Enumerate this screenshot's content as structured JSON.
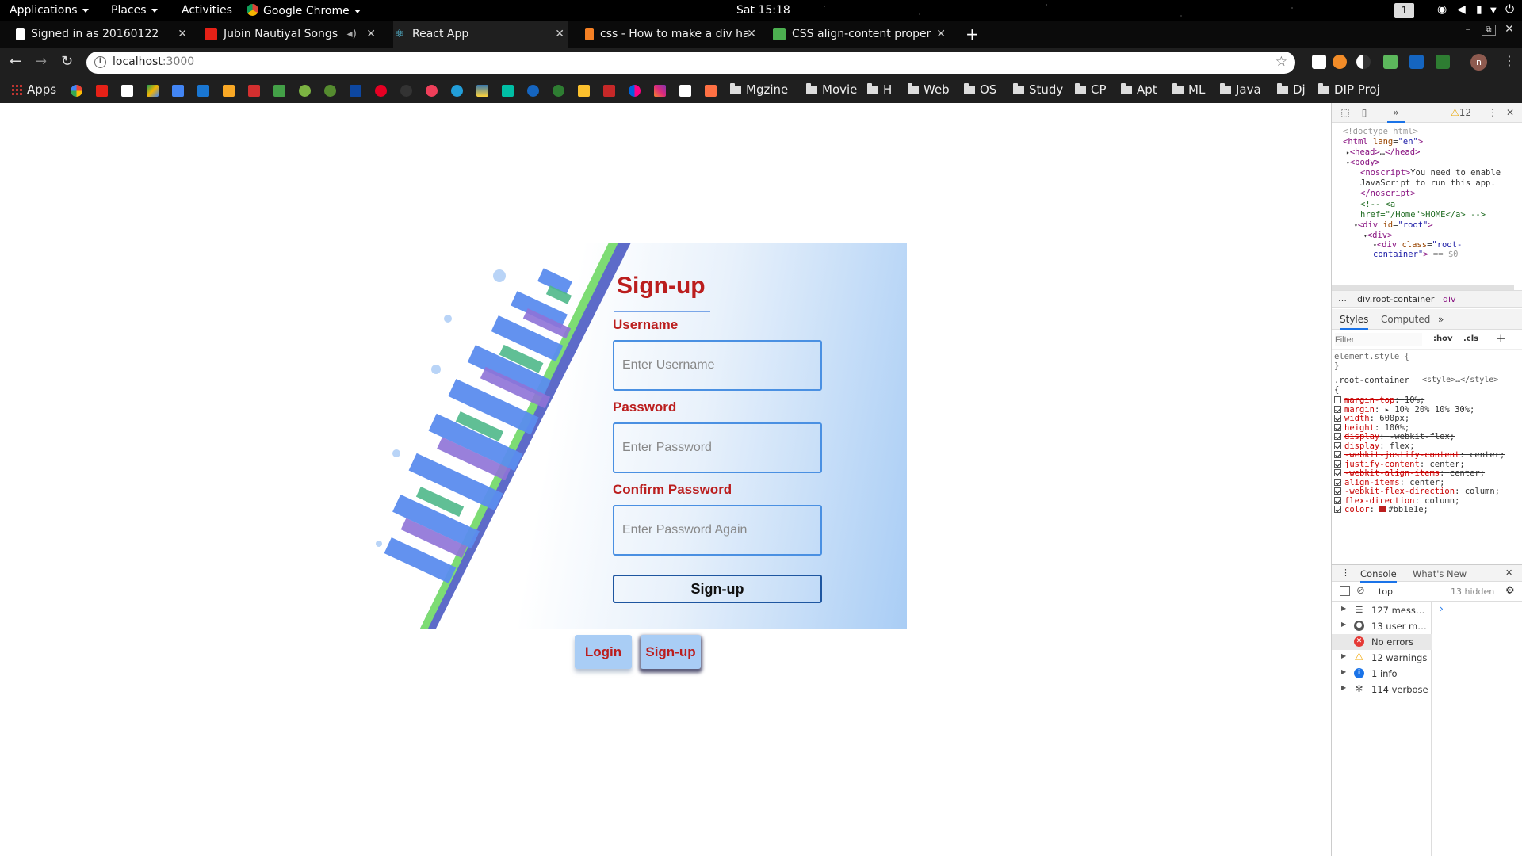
{
  "topbar": {
    "applications": "Applications",
    "places": "Places",
    "activities": "Activities",
    "chrome": "Google Chrome",
    "clock": "Sat 15:18",
    "workspace": "1"
  },
  "tabs": [
    {
      "title": "Signed in as 20160122"
    },
    {
      "title": "Jubin Nautiyal Songs"
    },
    {
      "title": "React App"
    },
    {
      "title": "css - How to make a div ha"
    },
    {
      "title": "CSS align-content proper"
    }
  ],
  "omnibox": {
    "url_host": "localhost",
    "url_port": ":3000"
  },
  "avatar_letter": "n",
  "bookmarks": {
    "apps": "Apps",
    "folders": [
      "Mgzine",
      "Movie",
      "H",
      "Web",
      "OS",
      "Study",
      "CP",
      "Apt",
      "ML",
      "Java",
      "Dj",
      "DIP Proj"
    ]
  },
  "page": {
    "title": "Sign-up",
    "username_label": "Username",
    "username_placeholder": "Enter Username",
    "password_label": "Password",
    "password_placeholder": "Enter Password",
    "confirm_label": "Confirm Password",
    "confirm_placeholder": "Enter Password Again",
    "submit": "Sign-up",
    "nav_login": "Login",
    "nav_signup": "Sign-up"
  },
  "colors": {
    "accent": "#bb1e1e",
    "input_border": "#4a90e2",
    "button_bg": "#a9cdf5"
  },
  "devtools": {
    "warnings_badge": "12",
    "elements": {
      "doctype": "<!doctype html>",
      "html_open_tag": "html",
      "lang_attr": "lang",
      "lang_val": "\"en\"",
      "head": "head",
      "head_ellipsis": "…",
      "body": "body",
      "noscript": "noscript",
      "noscript_text_1": "You need to enable",
      "noscript_text_2": "JavaScript to run this app.",
      "noscript_close": "/noscript",
      "comment_1": "<!-- <a",
      "comment_2": "href=\"/Home\">HOME</a> -->",
      "div": "div",
      "id_attr": "id",
      "root_val": "\"root\"",
      "class_attr": "class",
      "rc_val_1": "\"root-",
      "rc_val_2": "container\"",
      "selected_marker": "== $0"
    },
    "breadcrumbs": [
      "div.root-container",
      "div"
    ],
    "style_tabs": [
      "Styles",
      "Computed"
    ],
    "filter_placeholder": "Filter",
    "hov": ":hov",
    "cls": ".cls",
    "element_style": "element.style {",
    "rule_selector": ".root-container",
    "rule_source": "<style>…</style>",
    "declarations": [
      {
        "name": "margin-top",
        "value": "10%;",
        "on": false,
        "struck": true
      },
      {
        "name": "margin",
        "value": "▸ 10% 20% 10% 30%;",
        "on": true,
        "struck": false
      },
      {
        "name": "width",
        "value": "600px;",
        "on": true,
        "struck": false
      },
      {
        "name": "height",
        "value": "100%;",
        "on": true,
        "struck": false
      },
      {
        "name": "display",
        "value": "-webkit-flex;",
        "on": true,
        "struck": true
      },
      {
        "name": "display",
        "value": "flex;",
        "on": true,
        "struck": false
      },
      {
        "name": "-webkit-justify-content",
        "value": "center;",
        "on": true,
        "struck": true
      },
      {
        "name": "justify-content",
        "value": "center;",
        "on": true,
        "struck": false
      },
      {
        "name": "-webkit-align-items",
        "value": "center;",
        "on": true,
        "struck": true
      },
      {
        "name": "align-items",
        "value": "center;",
        "on": true,
        "struck": false
      },
      {
        "name": "-webkit-flex-direction",
        "value": "column;",
        "on": true,
        "struck": true
      },
      {
        "name": "flex-direction",
        "value": "column;",
        "on": true,
        "struck": false
      },
      {
        "name": "color",
        "value": "#bb1e1e;",
        "on": true,
        "struck": false
      }
    ],
    "drawer_tabs": [
      "Console",
      "What's New"
    ],
    "console_context": "top",
    "hidden_count": "13 hidden",
    "console_items": [
      {
        "label": "127 messa…",
        "icon": "list-icon"
      },
      {
        "label": "13 user me…",
        "icon": "user-icon"
      },
      {
        "label": "No errors",
        "icon": "error-icon"
      },
      {
        "label": "12 warnings",
        "icon": "warning-icon"
      },
      {
        "label": "1 info",
        "icon": "info-icon"
      },
      {
        "label": "114 verbose",
        "icon": "bug-icon"
      }
    ]
  }
}
